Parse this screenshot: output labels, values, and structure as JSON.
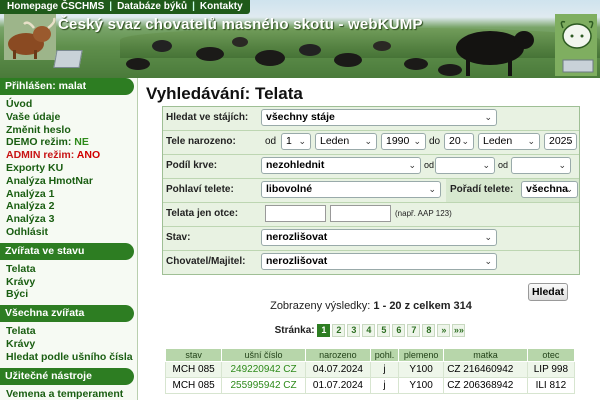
{
  "header": {
    "nav": [
      "Homepage ČSCHMS",
      "Databáze býků",
      "Kontakty"
    ],
    "nav_sep": "|",
    "title": "Český svaz chovatelů masného skotu - webKUMP"
  },
  "sidebar": {
    "login_head": "Přihlášen: malat",
    "menu": [
      {
        "label": "Úvod"
      },
      {
        "label": "Vaše údaje"
      },
      {
        "label": "Změnit heslo"
      }
    ],
    "demo": {
      "label": "DEMO režim:",
      "value": "NE"
    },
    "admin": {
      "label": "ADMIN režim:",
      "value": "ANO"
    },
    "menu2": [
      {
        "label": "Exporty KU"
      },
      {
        "label": "Analýza HmotNar"
      },
      {
        "label": "Analýza 1"
      },
      {
        "label": "Analýza 2"
      },
      {
        "label": "Analýza 3"
      },
      {
        "label": "Odhlásit"
      }
    ],
    "section_stav": "Zvířata ve stavu",
    "stav_items": [
      {
        "label": "Telata"
      },
      {
        "label": "Krávy"
      },
      {
        "label": "Býci"
      }
    ],
    "section_all": "Všechna zvířata",
    "all_items": [
      {
        "label": "Telata"
      },
      {
        "label": "Krávy"
      },
      {
        "label": "Hledat podle ušního čísla"
      }
    ],
    "section_tools": "Užitečné nástroje",
    "tools_items": [
      {
        "label": "Vemena a temperament"
      }
    ]
  },
  "main": {
    "title": "Vyhledávání: Telata",
    "form": {
      "hledat_label": "Hledat ve stájích:",
      "hledat_value": "všechny stáje",
      "narozeno_label": "Tele narozeno:",
      "od": "od",
      "do": "do",
      "from_day": "1",
      "from_month": "Leden",
      "from_year": "1990",
      "to_day": "20",
      "to_month": "Leden",
      "to_year": "2025",
      "krev_label": "Podíl krve:",
      "krev_value": "nezohlednit",
      "krev_od": "od",
      "pohlavi_label": "Pohlaví telete:",
      "pohlavi_value": "libovolné",
      "poradi_label": "Pořadí telete:",
      "poradi_value": "všechna",
      "otec_label": "Telata jen otce:",
      "otec_hint": "(např. AAP 123)",
      "stav_label": "Stav:",
      "stav_value": "nerozlišovat",
      "chovatel_label": "Chovatel/Majitel:",
      "chovatel_value": "nerozlišovat",
      "submit": "Hledat"
    },
    "results": {
      "prefix": "Zobrazeny výsledky:",
      "range": "1 - 20 z celkem 314"
    },
    "pager": {
      "label": "Stránka:",
      "pages": [
        "1",
        "2",
        "3",
        "4",
        "5",
        "6",
        "7",
        "8",
        "»",
        "»»"
      ],
      "active": "1"
    },
    "table": {
      "headers": [
        "stav",
        "ušní číslo",
        "narozeno",
        "pohl.",
        "plemeno",
        "matka",
        "otec"
      ],
      "rows": [
        [
          "MCH 085",
          "249220942 CZ",
          "04.07.2024",
          "j",
          "Y100",
          "CZ 216460942",
          "LIP 998"
        ],
        [
          "MCH 085",
          "255995942 CZ",
          "01.07.2024",
          "j",
          "Y100",
          "CZ 206368942",
          "ILI 812"
        ]
      ]
    }
  },
  "colors": {
    "brand_green": "#2d7d22",
    "link_green": "#1a5e12",
    "admin_red": "#c81414"
  }
}
